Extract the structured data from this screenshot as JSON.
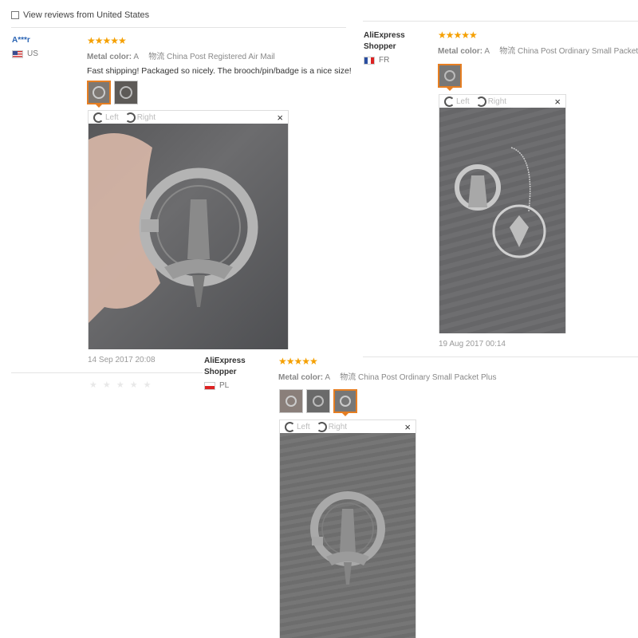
{
  "filter": {
    "label": "View reviews from United States"
  },
  "reviews": [
    {
      "user": "A***r",
      "country": "US",
      "stars": "★★★★★",
      "metal_label": "Metal color:",
      "metal_value": "A",
      "shipping": "物流 China Post Registered Air Mail",
      "text": "Fast shipping! Packaged so nicely. The brooch/pin/badge is a nice size!",
      "date": "14 Sep 2017 20:08",
      "viewer": {
        "left": "Left",
        "right": "Right",
        "close": "×"
      }
    },
    {
      "user": "AliExpress Shopper",
      "user_line1": "AliExpress",
      "user_line2": "Shopper",
      "country": "FR",
      "stars": "★★★★★",
      "metal_label": "Metal color:",
      "metal_value": "A",
      "shipping": "物流 China Post Ordinary Small Packet",
      "date": "19 Aug 2017 00:14",
      "viewer": {
        "left": "Left",
        "right": "Right",
        "close": "×"
      }
    },
    {
      "user_line1": "AliExpress",
      "user_line2": "Shopper",
      "country": "PL",
      "stars": "★★★★★",
      "metal_label": "Metal color:",
      "metal_value": "A",
      "shipping": "物流 China Post Ordinary Small Packet Plus",
      "viewer": {
        "left": "Left",
        "right": "Right",
        "close": "×"
      }
    }
  ],
  "faded_stars": "★ ★ ★ ★ ★",
  "colors": {
    "star": "#f5a000",
    "active_thumb": "#e67e22",
    "username_link": "#2a64b4"
  },
  "icons": [
    "checkbox-icon",
    "us-flag-icon",
    "fr-flag-icon",
    "pl-flag-icon",
    "rotate-left-icon",
    "rotate-right-icon",
    "close-icon"
  ]
}
